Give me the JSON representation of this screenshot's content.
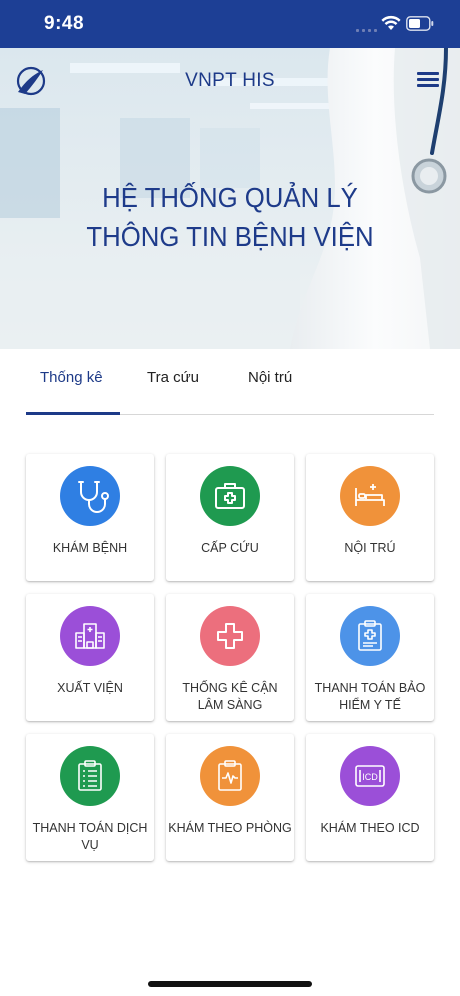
{
  "status_bar": {
    "time": "9:48"
  },
  "header": {
    "title": "VNPT HIS"
  },
  "hero": {
    "line1": "HỆ THỐNG QUẢN LÝ",
    "line2": "THÔNG TIN BỆNH VIỆN"
  },
  "tabs": [
    {
      "label": "Thống kê",
      "active": true
    },
    {
      "label": "Tra cứu",
      "active": false
    },
    {
      "label": "Nội trú",
      "active": false
    }
  ],
  "menu_items": [
    {
      "label": "KHÁM BỆNH",
      "icon": "stethoscope-icon",
      "color": "#2f7fe3"
    },
    {
      "label": "CẤP CỨU",
      "icon": "first-aid-kit-icon",
      "color": "#1f9a50"
    },
    {
      "label": "NỘI TRÚ",
      "icon": "hospital-bed-icon",
      "color": "#f0923a"
    },
    {
      "label": "XUẤT VIỆN",
      "icon": "hospital-building-icon",
      "color": "#9b4fd8"
    },
    {
      "label": "THỐNG KÊ CẬN LÂM SÀNG",
      "icon": "medical-cross-icon",
      "color": "#ec6f7d"
    },
    {
      "label": "THANH TOÁN BẢO HIỂM Y TẾ",
      "icon": "insurance-clipboard-icon",
      "color": "#4d93e8"
    },
    {
      "label": "THANH TOÁN DỊCH VỤ",
      "icon": "checklist-icon",
      "color": "#1f9a50"
    },
    {
      "label": "KHÁM THEO PHÒNG",
      "icon": "heartbeat-clipboard-icon",
      "color": "#f0923a"
    },
    {
      "label": "KHÁM THEO ICD",
      "icon": "icd-card-icon",
      "color": "#9b4fd8"
    }
  ],
  "colors": {
    "status_bar": "#1d3f95",
    "brand": "#1d3a88"
  }
}
